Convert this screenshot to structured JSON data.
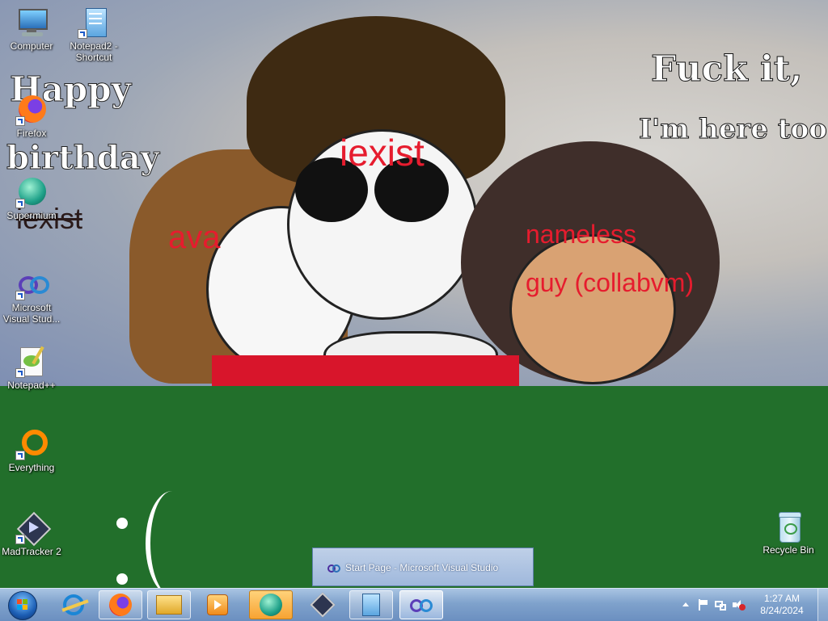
{
  "wallpaper": {
    "labels": {
      "ava": "ava",
      "iexist": "iexist",
      "nameless": "nameless",
      "guy": "guy (collabvm)",
      "iexist_small": "iexist"
    },
    "handwriting": {
      "happy": "Happy",
      "birthday": "birthday",
      "fuck": "Fuck it,",
      "here": "I'm here too"
    },
    "colors": {
      "sky": "#8ea0c0",
      "ground": "#226f2b",
      "label": "#e61c2e"
    }
  },
  "desktop": {
    "icons": [
      {
        "label": "Computer",
        "icon": "computer-icon"
      },
      {
        "label": "Notepad2 - Shortcut",
        "icon": "notepad2-icon"
      },
      {
        "label": "Firefox",
        "icon": "firefox-icon"
      },
      {
        "label": "Supermium",
        "icon": "supermium-icon"
      },
      {
        "label": "Microsoft Visual Stud...",
        "icon": "visual-studio-icon"
      },
      {
        "label": "Notepad++",
        "icon": "notepad-plus-plus-icon"
      },
      {
        "label": "Everything",
        "icon": "everything-icon"
      },
      {
        "label": "MadTracker 2",
        "icon": "madtracker-icon"
      },
      {
        "label": "Recycle Bin",
        "icon": "recycle-bin-icon"
      }
    ]
  },
  "taskbar": {
    "thumbnail_label": "Start Page - Microsoft Visual Studio",
    "clock": {
      "time": "1:27 AM",
      "date": "8/24/2024"
    },
    "buttons": [
      {
        "icon": "internet-explorer-icon"
      },
      {
        "icon": "firefox-icon"
      },
      {
        "icon": "file-explorer-icon"
      },
      {
        "icon": "media-player-icon"
      },
      {
        "icon": "supermium-icon"
      },
      {
        "icon": "madtracker-icon"
      },
      {
        "icon": "notepad2-icon"
      },
      {
        "icon": "visual-studio-icon"
      }
    ]
  }
}
